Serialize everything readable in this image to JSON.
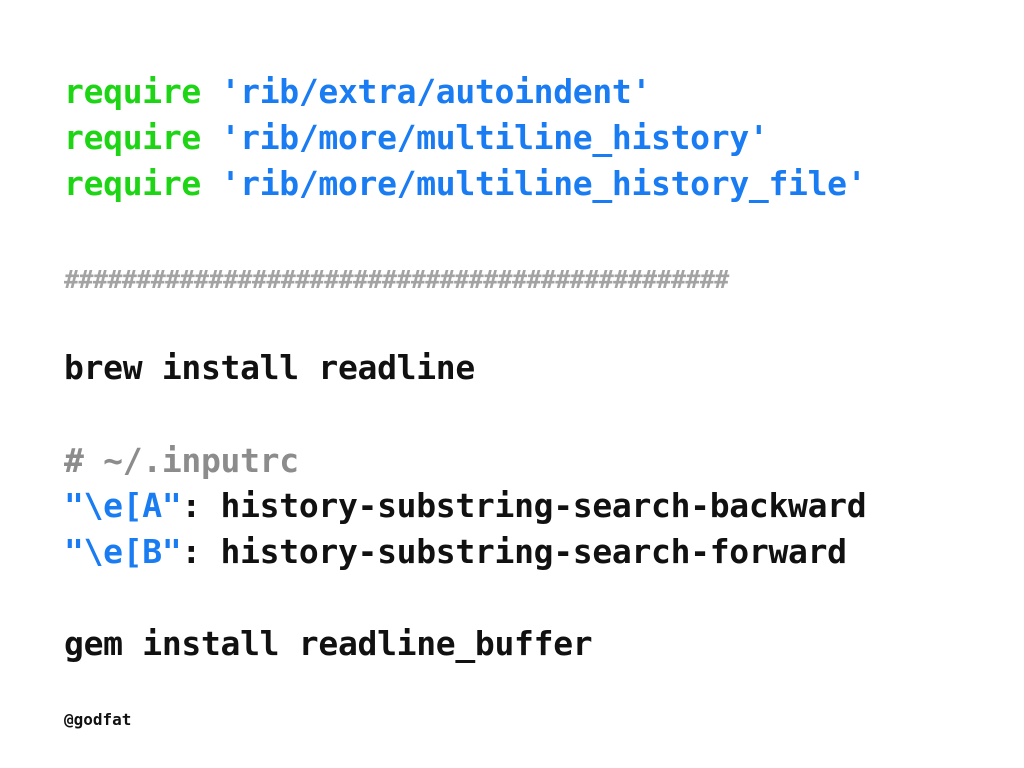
{
  "colors": {
    "keyword": "#1ed515",
    "string": "#1a7cf2",
    "plain": "#111111",
    "comment": "#8c8c8c"
  },
  "requires": [
    {
      "keyword": "require",
      "path": "'rib/extra/autoindent'"
    },
    {
      "keyword": "require",
      "path": "'rib/more/multiline_history'"
    },
    {
      "keyword": "require",
      "path": "'rib/more/multiline_history_file'"
    }
  ],
  "separator": "##############################################",
  "brew_command": "brew install readline",
  "inputrc": {
    "comment": "# ~/.inputrc",
    "bindings": [
      {
        "key": "\"\\e[A\"",
        "colon": ":",
        "action": " history-substring-search-backward"
      },
      {
        "key": "\"\\e[B\"",
        "colon": ":",
        "action": " history-substring-search-forward"
      }
    ]
  },
  "gem_command": "gem install readline_buffer",
  "author_handle": "@godfat"
}
